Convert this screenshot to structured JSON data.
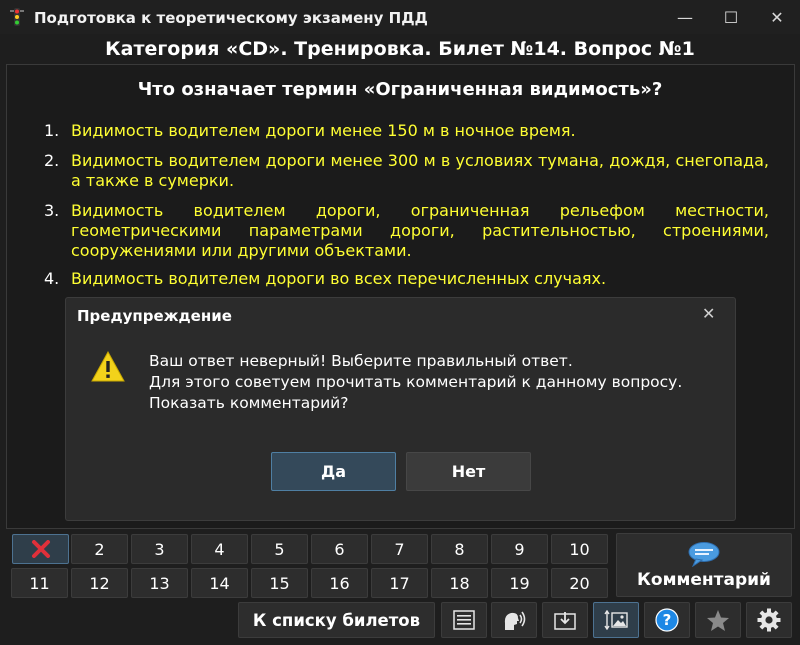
{
  "window": {
    "title": "Подготовка к теоретическому экзамену ПДД",
    "min_icon": "minimize-icon",
    "max_icon": "maximize-icon",
    "close_icon": "close-icon",
    "min_glyph": "—",
    "max_glyph": "☐",
    "close_glyph": "✕"
  },
  "header": {
    "title": "Категория «CD». Тренировка. Билет №14. Вопрос №1"
  },
  "question": {
    "text": "Что означает термин «Ограниченная видимость»?"
  },
  "answers": [
    {
      "num": "1.",
      "text": "Видимость водителем дороги менее 150 м в ночное время."
    },
    {
      "num": "2.",
      "text": "Видимость водителем дороги менее 300 м в условиях тумана, дождя, снегопада, а также в сумерки."
    },
    {
      "num": "3.",
      "text": "Видимость водителем дороги, ограниченная рельефом местности, геометрическими параметрами дороги, растительностью, строениями, сооружениями или другими объектами."
    },
    {
      "num": "4.",
      "text": "Видимость водителем дороги во всех перечисленных случаях."
    }
  ],
  "dialog": {
    "title": "Предупреждение",
    "close_glyph": "✕",
    "icon": "warning-icon",
    "lines": [
      "Ваш ответ неверный! Выберите правильный ответ.",
      "Для этого советуем прочитать комментарий к данному вопросу.",
      "Показать комментарий?"
    ],
    "yes_label": "Да",
    "no_label": "Нет"
  },
  "navigation": {
    "first_icon": "wrong-answer-x-icon",
    "questions": [
      "2",
      "3",
      "4",
      "5",
      "6",
      "7",
      "8",
      "9",
      "10",
      "11",
      "12",
      "13",
      "14",
      "15",
      "16",
      "17",
      "18",
      "19",
      "20"
    ]
  },
  "comment_button": {
    "label": "Комментарий",
    "icon": "speech-bubble-icon"
  },
  "list_button": {
    "label": "К списку билетов"
  },
  "toolbar": {
    "icons": [
      "list-icon",
      "speak-icon",
      "download-icon",
      "image-resize-icon",
      "help-icon",
      "star-icon",
      "gear-icon"
    ]
  },
  "colors": {
    "answer_text": "#ffff33",
    "accent_blue": "#4f7fa3",
    "error_red": "#e0303a",
    "warning_yellow": "#f2d21b"
  }
}
